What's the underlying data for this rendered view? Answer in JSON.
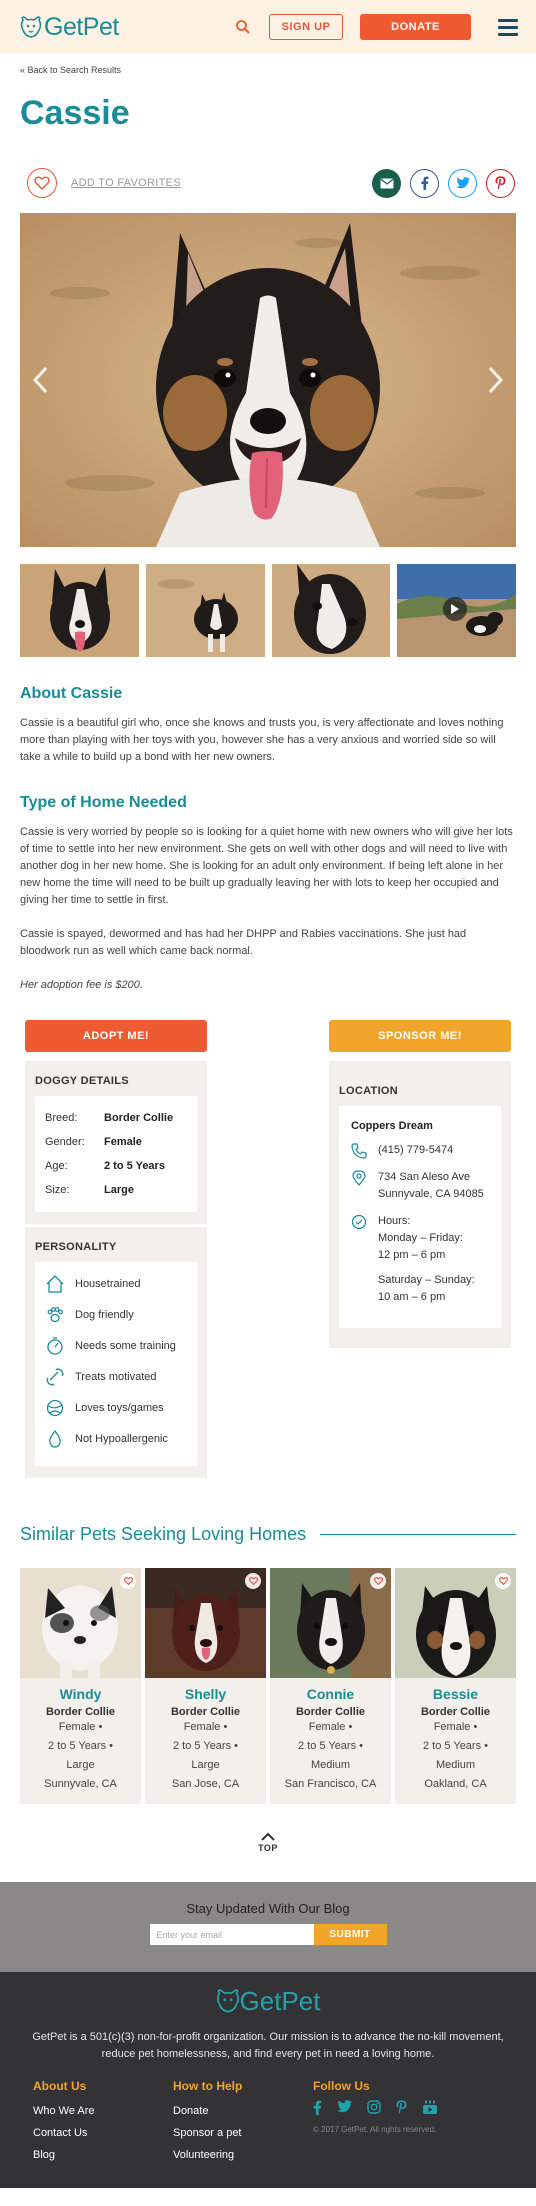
{
  "header": {
    "logo_text": "GetPet",
    "signup_label": "SIGN UP",
    "donate_label": "DONATE"
  },
  "nav": {
    "back_label": "« Back to Search Results"
  },
  "pet": {
    "name": "Cassie",
    "favorite_label": "ADD TO FAVORITES",
    "about_title": "About Cassie",
    "about_text": "Cassie is a beautiful girl who, once she knows and trusts you, is very affectionate and loves nothing more than playing with her toys with you, however she has a very anxious and worried side so will take a while to build up a bond with her new owners.",
    "home_title": "Type of Home Needed",
    "home_text_1": "Cassie is very worried by people so is looking for a quiet home with new owners who will give her lots of time to settle into her new environment. She gets on well with other dogs and will need to live with another dog in her new home. She is looking for an adult only environment. If being left alone in her new home the time will need to be built up gradually leaving her with lots to keep her occupied and giving her time to settle in first.",
    "home_text_2": "Cassie is spayed, dewormed and has had her DHPP and Rabies vaccinations. She just had bloodwork run as well which came back normal.",
    "fee_text": "Her adoption fee is $200."
  },
  "actions": {
    "adopt_label": "ADOPT ME!",
    "sponsor_label": "SPONSOR ME!"
  },
  "details": {
    "title": "DOGGY DETAILS",
    "rows": [
      {
        "key": "Breed:",
        "value": "Border Collie"
      },
      {
        "key": "Gender:",
        "value": "Female"
      },
      {
        "key": "Age:",
        "value": "2 to 5 Years"
      },
      {
        "key": "Size:",
        "value": "Large"
      }
    ]
  },
  "personality": {
    "title": "PERSONALITY",
    "traits": [
      {
        "label": "Housetrained",
        "icon": "house-icon"
      },
      {
        "label": "Dog friendly",
        "icon": "paw-icon"
      },
      {
        "label": "Needs some training",
        "icon": "stopwatch-icon"
      },
      {
        "label": "Treats motivated",
        "icon": "bone-icon"
      },
      {
        "label": "Loves toys/games",
        "icon": "ball-icon"
      },
      {
        "label": "Not Hypoallergenic",
        "icon": "droplet-icon"
      }
    ]
  },
  "location": {
    "title": "LOCATION",
    "name": "Coppers Dream",
    "phone": "(415) 779-5474",
    "address_1": "734 San Aleso Ave",
    "address_2": "Sunnyvale, CA 94085",
    "hours_label": "Hours:",
    "weekday_days": "Monday – Friday:",
    "weekday_time": "12 pm – 6 pm",
    "weekend_days": "Saturday – Sunday:",
    "weekend_time": "10 am – 6 pm"
  },
  "similar": {
    "title": "Similar Pets Seeking Loving Homes",
    "pets": [
      {
        "name": "Windy",
        "breed": "Border Collie",
        "gender": "Female •",
        "age": "2 to 5 Years •",
        "size": "Large",
        "city": "Sunnyvale, CA"
      },
      {
        "name": "Shelly",
        "breed": "Border Collie",
        "gender": "Female •",
        "age": "2 to 5 Years •",
        "size": "Large",
        "city": "San Jose, CA"
      },
      {
        "name": "Connie",
        "breed": "Border Collie",
        "gender": "Female •",
        "age": "2 to 5 Years •",
        "size": "Medium",
        "city": "San Francisco, CA"
      },
      {
        "name": "Bessie",
        "breed": "Border Collie",
        "gender": "Female •",
        "age": "2 to 5 Years •",
        "size": "Medium",
        "city": "Oakland, CA"
      }
    ]
  },
  "top_label": "TOP",
  "blog": {
    "title": "Stay Updated With Our Blog",
    "placeholder": "Enter your email",
    "submit_label": "SUBMIT"
  },
  "footer": {
    "logo_text": "GetPet",
    "mission": "GetPet is a 501(c)(3) non-for-profit organization. Our mission is to advance the no-kill movement, reduce pet homelessness, and find every pet in need a loving home.",
    "about_title": "About Us",
    "about_links": [
      "Who We Are",
      "Contact Us",
      "Blog"
    ],
    "help_title": "How to Help",
    "help_links": [
      "Donate",
      "Sponsor a pet",
      "Volunteering"
    ],
    "follow_title": "Follow Us",
    "copyright": "© 2017 GetPet.  All rights reserved."
  },
  "colors": {
    "teal": "#1a8c97",
    "orange": "#ef5a32",
    "amber": "#f2a52b",
    "cream": "#fdf1e3",
    "panel": "#f3f0ec",
    "footer": "#333234"
  }
}
